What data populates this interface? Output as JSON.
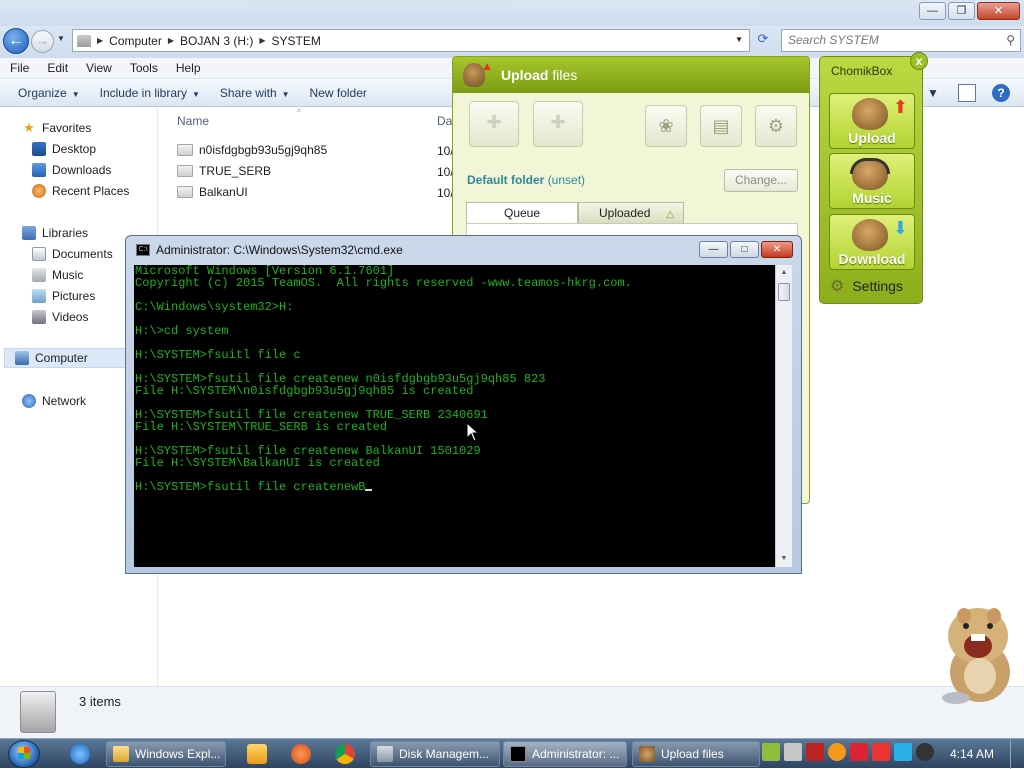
{
  "explorer": {
    "breadcrumb": [
      "Computer",
      "BOJAN 3 (H:)",
      "SYSTEM"
    ],
    "search_placeholder": "Search SYSTEM",
    "menu": [
      "File",
      "Edit",
      "View",
      "Tools",
      "Help"
    ],
    "toolbar": [
      "Organize",
      "Include in library",
      "Share with",
      "New folder"
    ],
    "nav": {
      "favorites": "Favorites",
      "desktop": "Desktop",
      "downloads": "Downloads",
      "recent": "Recent Places",
      "libraries": "Libraries",
      "documents": "Documents",
      "music": "Music",
      "pictures": "Pictures",
      "videos": "Videos",
      "computer": "Computer",
      "network": "Network"
    },
    "columns": {
      "name": "Name",
      "date": "Da"
    },
    "files": [
      {
        "name": "n0isfdgbgb93u5gj9qh85",
        "date": "10/"
      },
      {
        "name": "TRUE_SERB",
        "date": "10/"
      },
      {
        "name": "BalkanUI",
        "date": "10/"
      }
    ],
    "status": "3 items"
  },
  "upload": {
    "title_bold": "Upload",
    "title_rest": " files",
    "default_folder_label": "Default folder",
    "default_folder_value": "(unset)",
    "change_button": "Change...",
    "tab_queue": "Queue",
    "tab_uploaded": "Uploaded"
  },
  "chomikbox": {
    "title": "ChomikBox",
    "upload": "Upload",
    "music": "Music",
    "download": "Download",
    "settings": "Settings"
  },
  "cmd": {
    "title": "Administrator: C:\\Windows\\System32\\cmd.exe",
    "lines": [
      "Microsoft Windows [Version 6.1.7601]",
      "Copyright (c) 2015 TeamOS.  All rights reserved -www.teamos-hkrg.com.",
      "",
      "C:\\Windows\\system32>H:",
      "",
      "H:\\>cd system",
      "",
      "H:\\SYSTEM>fsuitl file c",
      "",
      "H:\\SYSTEM>fsutil file createnew n0isfdgbgb93u5gj9qh85 823",
      "File H:\\SYSTEM\\n0isfdgbgb93u5gj9qh85 is created",
      "",
      "H:\\SYSTEM>fsutil file createnew TRUE_SERB 2340691",
      "File H:\\SYSTEM\\TRUE_SERB is created",
      "",
      "H:\\SYSTEM>fsutil file createnew BalkanUI 1501029",
      "File H:\\SYSTEM\\BalkanUI is created",
      "",
      "H:\\SYSTEM>fsutil file createnewB"
    ]
  },
  "taskbar": {
    "items": [
      "Windows Expl...",
      "Disk Managem...",
      "Administrator: ...",
      "Upload files"
    ],
    "clock": "4:14 AM"
  },
  "colors": {
    "console_text": "#1bb31b",
    "upload_header": "#8fb01c",
    "chomik_green": "#b2d330"
  }
}
